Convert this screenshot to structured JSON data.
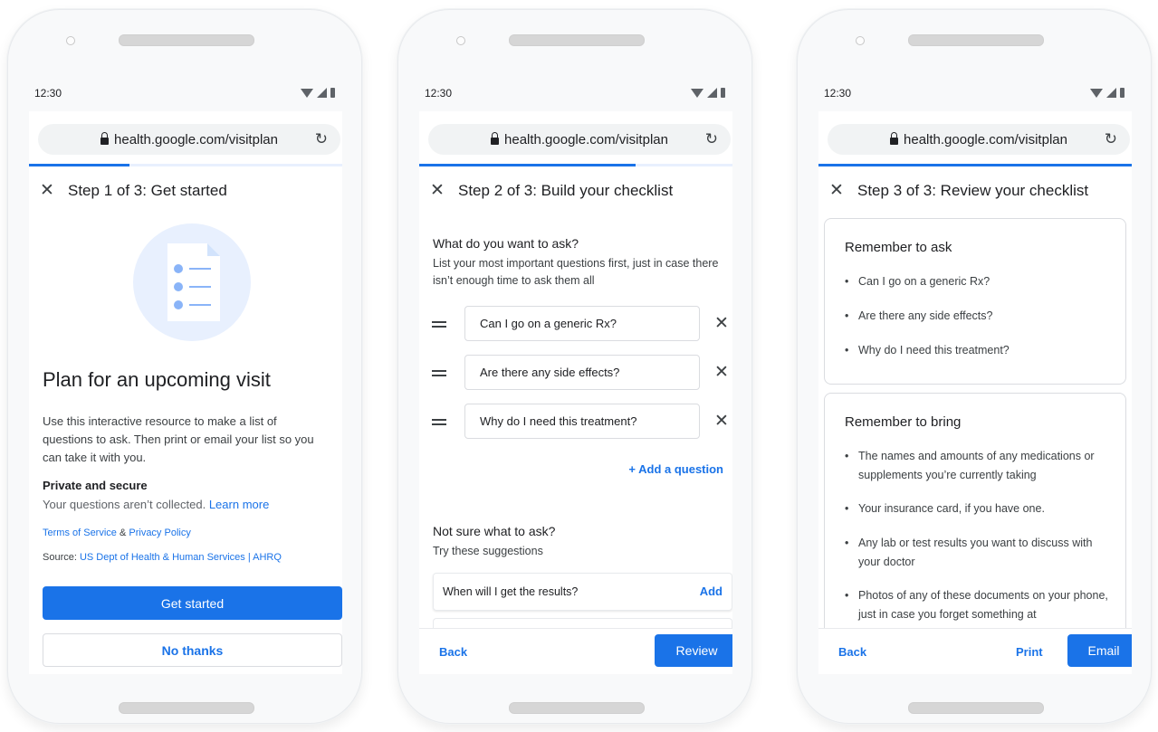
{
  "status_time": "12:30",
  "url": "health.google.com/visitplan",
  "screen1": {
    "step_title": "Step 1 of 3:  Get started",
    "progress": 0.32,
    "headline": "Plan for an upcoming visit",
    "description": "Use this interactive resource to make a list of questions to ask. Then print or email your list so you can take it with you.",
    "private_title": "Private and secure",
    "private_text": "Your questions aren’t collected.",
    "learn_more": "Learn more",
    "terms": "Terms of Service",
    "amp": " & ",
    "privacy": "Privacy Policy",
    "source_label": "Source: ",
    "source_link": "US Dept of Health & Human Services | AHRQ",
    "get_started": "Get started",
    "no_thanks": "No thanks"
  },
  "screen2": {
    "step_title": "Step 2 of 3:  Build your checklist",
    "progress": 0.69,
    "ask_title": "What do you want to ask?",
    "ask_hint": "List your most important questions first, just in case there isn’t enough time to ask them all",
    "questions": [
      "Can I go on a generic Rx?",
      "Are there any side effects?",
      "Why do I need this treatment?"
    ],
    "add_question": "+ Add a question",
    "not_sure_title": "Not sure what to ask?",
    "not_sure_hint": "Try these suggestions",
    "suggestion": "When will I get the results?",
    "add": "Add",
    "back": "Back",
    "review": "Review"
  },
  "screen3": {
    "step_title": "Step 3 of 3:  Review your checklist",
    "progress": 1.0,
    "ask_title": "Remember to ask",
    "ask_items": [
      "Can I go on a generic Rx?",
      "Are there any side effects?",
      "Why do I need this treatment?"
    ],
    "bring_title": "Remember to bring",
    "bring_items": [
      "The names and amounts of any medications or supplements you’re currently taking",
      "Your insurance card, if you have one.",
      "Any lab or test results you want to discuss with your doctor",
      "Photos of any of these documents on your phone, just in case you forget something at"
    ],
    "back": "Back",
    "print": "Print",
    "email": "Email"
  },
  "colors": {
    "accent": "#1a73e8",
    "progress_track": "#e8f0fe"
  },
  "icons": [
    "close-icon",
    "lock-icon",
    "reload-icon",
    "drag-handle-icon",
    "wifi-icon",
    "signal-icon",
    "battery-icon",
    "document-checklist-icon"
  ]
}
